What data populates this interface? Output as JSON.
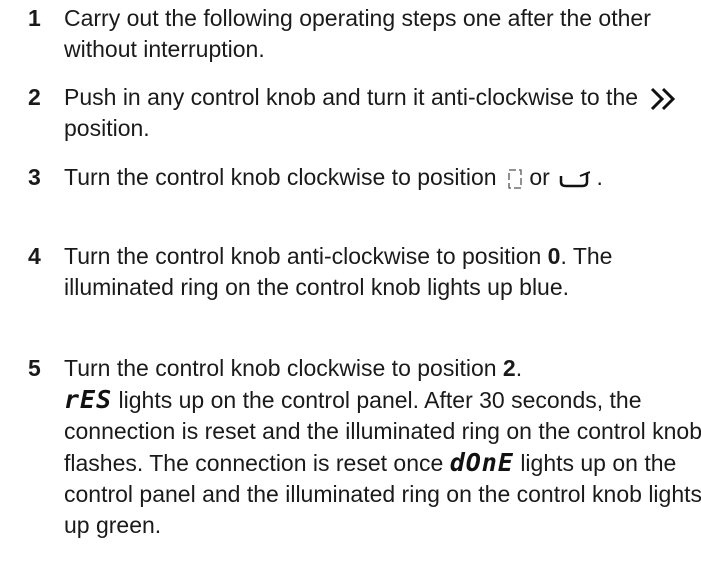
{
  "steps": [
    {
      "number": "1",
      "text": "Carry out the following operating steps one after the other without interruption."
    },
    {
      "number": "2",
      "text_before": "Push in any control knob and turn it anti-clockwise to the",
      "symbol": "double-chevron-right-icon",
      "text_after": "position."
    },
    {
      "number": "3",
      "text_before": "Turn the control knob clockwise to position",
      "symbol_1": "rectangle-burner-icon",
      "text_middle": "or",
      "symbol_2": "roaster-burner-icon",
      "text_after": "."
    },
    {
      "number": "4",
      "text_before": "Turn the control knob anti-clockwise to position",
      "position": "0",
      "text_after": ". The illuminated ring on the control knob lights up blue."
    },
    {
      "number": "5",
      "text_before": "Turn the control knob clockwise to position",
      "position": "2",
      "text_after": ".",
      "display_1": "rES",
      "text_2": "lights up on the control panel. After 30 seconds, the connection is reset and the illuminated ring on the control knob flashes. The connection is reset once",
      "display_2": "dOnE",
      "text_3": "lights up on the control panel and the illuminated ring on the control knob lights up green."
    }
  ]
}
